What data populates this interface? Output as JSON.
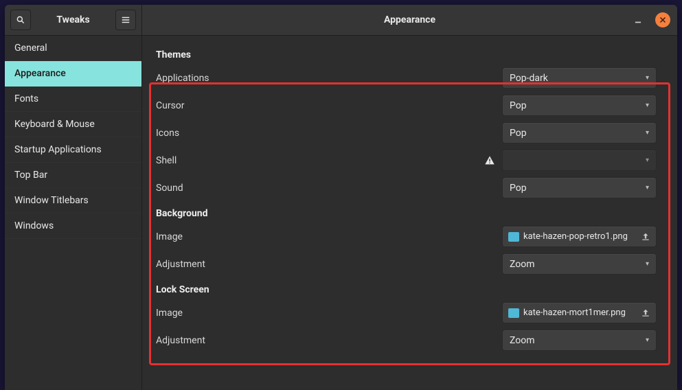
{
  "app_title": "Tweaks",
  "page_title": "Appearance",
  "sidebar": {
    "items": [
      {
        "label": "General",
        "selected": false
      },
      {
        "label": "Appearance",
        "selected": true
      },
      {
        "label": "Fonts",
        "selected": false
      },
      {
        "label": "Keyboard & Mouse",
        "selected": false
      },
      {
        "label": "Startup Applications",
        "selected": false
      },
      {
        "label": "Top Bar",
        "selected": false
      },
      {
        "label": "Window Titlebars",
        "selected": false
      },
      {
        "label": "Windows",
        "selected": false
      }
    ]
  },
  "sections": {
    "themes": {
      "heading": "Themes",
      "applications": {
        "label": "Applications",
        "value": "Pop-dark"
      },
      "cursor": {
        "label": "Cursor",
        "value": "Pop"
      },
      "icons": {
        "label": "Icons",
        "value": "Pop"
      },
      "shell": {
        "label": "Shell",
        "value": "",
        "warning": true
      },
      "sound": {
        "label": "Sound",
        "value": "Pop"
      }
    },
    "background": {
      "heading": "Background",
      "image": {
        "label": "Image",
        "value": "kate-hazen-pop-retro1.png"
      },
      "adjustment": {
        "label": "Adjustment",
        "value": "Zoom"
      }
    },
    "lock_screen": {
      "heading": "Lock Screen",
      "image": {
        "label": "Image",
        "value": "kate-hazen-mort1mer.png"
      },
      "adjustment": {
        "label": "Adjustment",
        "value": "Zoom"
      }
    }
  }
}
